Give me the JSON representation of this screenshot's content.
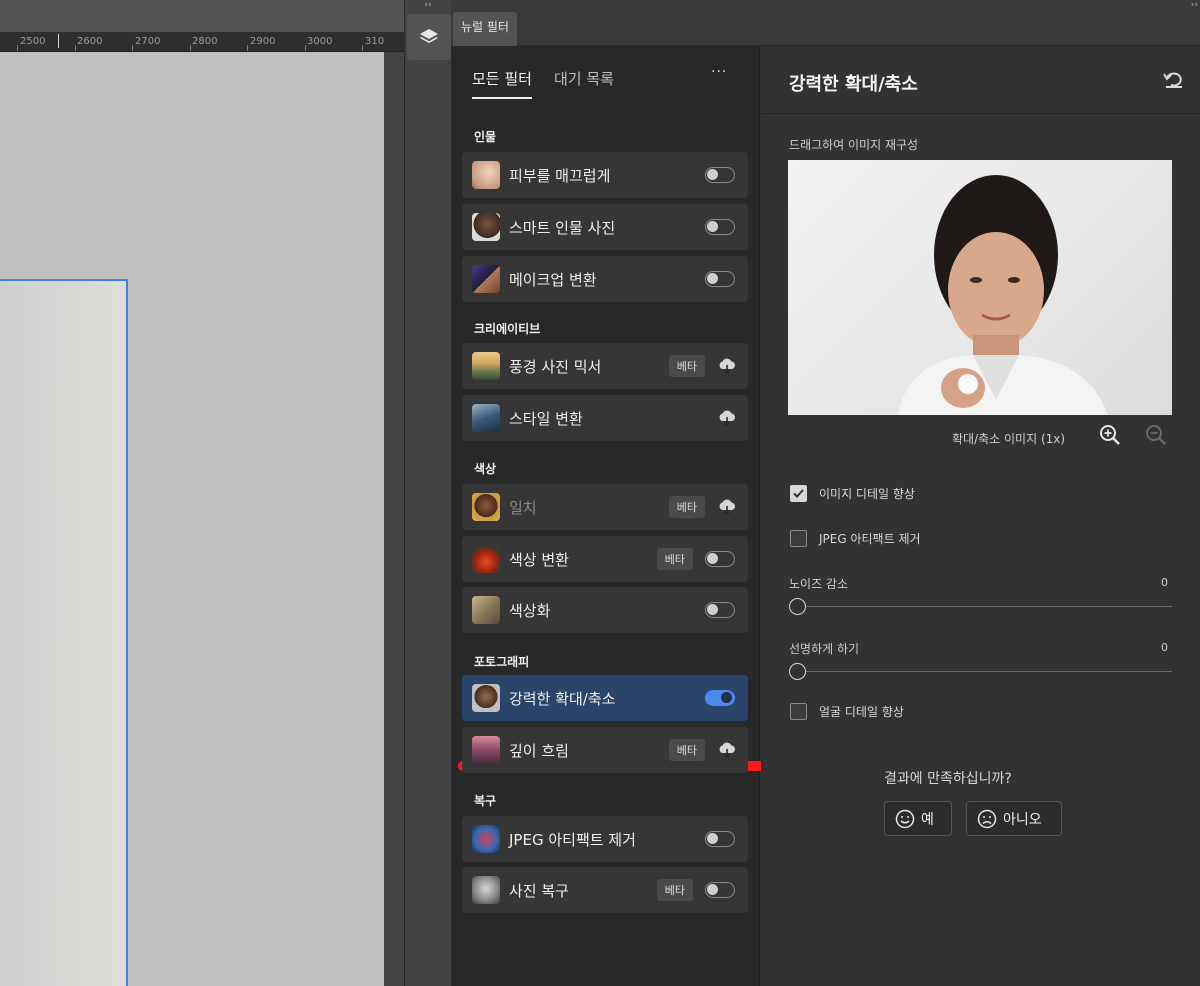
{
  "ruler": {
    "ticks": [
      "2500",
      "2600",
      "2700",
      "2800",
      "2900",
      "3000",
      "310"
    ]
  },
  "panel": {
    "tab_title": "뉴럴 필터"
  },
  "tabs": {
    "all_filters": "모든 필터",
    "waitlist": "대기 목록",
    "more": "···"
  },
  "sections": {
    "portraits": "인물",
    "creative": "크리에이티브",
    "color": "색상",
    "photography": "포토그래피",
    "restoration": "복구"
  },
  "items": {
    "skin_smoothing": {
      "label": "피부를 매끄럽게",
      "toggle_on": false
    },
    "smart_portrait": {
      "label": "스마트 인물 사진",
      "toggle_on": false
    },
    "makeup_transfer": {
      "label": "메이크업 변환",
      "toggle_on": false
    },
    "landscape_mixer": {
      "label": "풍경 사진 믹서",
      "badge": "베타"
    },
    "style_transfer": {
      "label": "스타일 변환"
    },
    "harmonization": {
      "label": "일치",
      "badge": "베타"
    },
    "color_transfer": {
      "label": "색상 변환",
      "badge": "베타",
      "toggle_on": false
    },
    "colorize": {
      "label": "색상화",
      "toggle_on": false
    },
    "super_zoom": {
      "label": "강력한 확대/축소",
      "toggle_on": true
    },
    "depth_blur": {
      "label": "깊이 흐림",
      "badge": "베타"
    },
    "jpeg_removal": {
      "label": "JPEG 아티팩트 제거",
      "toggle_on": false
    },
    "photo_restoration": {
      "label": "사진 복구",
      "badge": "베타",
      "toggle_on": false
    }
  },
  "detail": {
    "title": "강력한 확대/축소",
    "drag_label": "드래그하여 이미지 재구성",
    "zoom_label": "확대/축소 이미지 (1x)",
    "enhance_detail": {
      "label": "이미지 디테일 향상",
      "checked": true
    },
    "remove_jpeg": {
      "label": "JPEG 아티팩트 제거",
      "checked": false
    },
    "noise_reduction": {
      "label": "노이즈 감소",
      "value": "0"
    },
    "sharpen": {
      "label": "선명하게 하기",
      "value": "0"
    },
    "face_detail": {
      "label": "얼굴 디테일 향상",
      "checked": false
    },
    "feedback_question": "결과에 만족하십니까?",
    "yes": "예",
    "no": "아니오"
  },
  "colors": {
    "accent": "#4a8af0",
    "selected_row": "#2b4469",
    "annotation": "#ff1a1a"
  }
}
